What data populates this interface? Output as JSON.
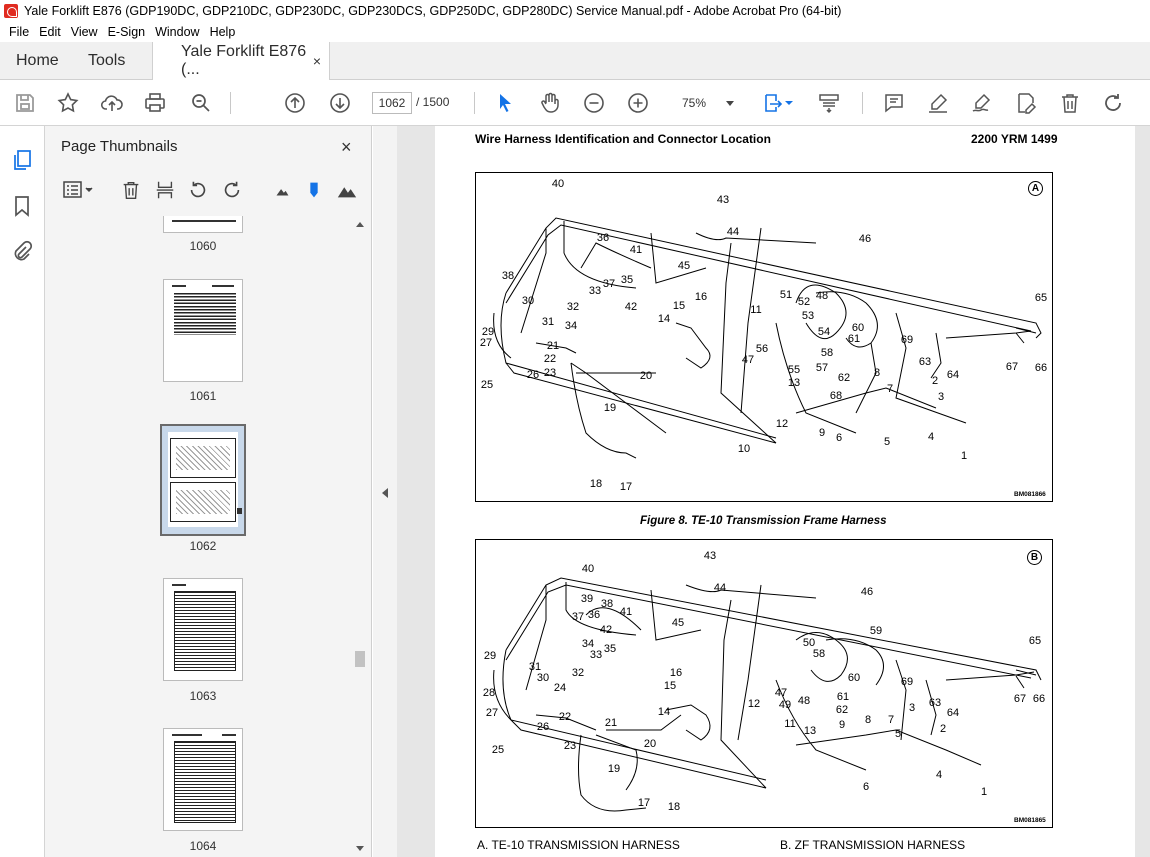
{
  "window": {
    "title": "Yale Forklift E876 (GDP190DC, GDP210DC, GDP230DC, GDP230DCS, GDP250DC, GDP280DC) Service Manual.pdf - Adobe Acrobat Pro (64-bit)"
  },
  "menu": [
    "File",
    "Edit",
    "View",
    "E-Sign",
    "Window",
    "Help"
  ],
  "tabs": {
    "home": "Home",
    "tools": "Tools",
    "doc": "Yale Forklift E876 (...",
    "close": "×"
  },
  "toolbar": {
    "page_current": "1062",
    "page_sep": "/ 1500",
    "zoom": "75%"
  },
  "thumbs": {
    "title": "Page Thumbnails",
    "close": "×",
    "pages": [
      {
        "label": "1060"
      },
      {
        "label": "1061"
      },
      {
        "label": "1062"
      },
      {
        "label": "1063"
      },
      {
        "label": "1064"
      }
    ],
    "selected": "1062"
  },
  "page": {
    "header_left": "Wire Harness Identification and Connector Location",
    "header_right": "2200 YRM 1499",
    "figA": {
      "badge": "A",
      "code": "BM081866",
      "labels": [
        "1",
        "2",
        "3",
        "4",
        "5",
        "6",
        "7",
        "8",
        "9",
        "10",
        "11",
        "12",
        "13",
        "14",
        "15",
        "16",
        "17",
        "18",
        "19",
        "20",
        "21",
        "22",
        "23",
        "25",
        "26",
        "27",
        "29",
        "30",
        "31",
        "32",
        "33",
        "34",
        "35",
        "36",
        "37",
        "38",
        "40",
        "41",
        "42",
        "43",
        "44",
        "45",
        "46",
        "47",
        "48",
        "51",
        "52",
        "53",
        "54",
        "55",
        "56",
        "57",
        "58",
        "60",
        "61",
        "62",
        "63",
        "64",
        "65",
        "66",
        "67",
        "68",
        "69"
      ]
    },
    "caption": "Figure 8.  TE-10 Transmission Frame Harness",
    "figB": {
      "badge": "B",
      "code": "BM081865",
      "labels": [
        "1",
        "2",
        "3",
        "4",
        "5",
        "6",
        "7",
        "8",
        "9",
        "11",
        "12",
        "13",
        "14",
        "15",
        "16",
        "17",
        "18",
        "19",
        "20",
        "21",
        "22",
        "23",
        "24",
        "25",
        "26",
        "27",
        "28",
        "29",
        "30",
        "31",
        "32",
        "33",
        "34",
        "35",
        "36",
        "37",
        "38",
        "39",
        "40",
        "41",
        "42",
        "43",
        "44",
        "45",
        "46",
        "47",
        "48",
        "49",
        "50",
        "58",
        "59",
        "60",
        "61",
        "62",
        "63",
        "64",
        "65",
        "66",
        "67",
        "69"
      ]
    },
    "legend": {
      "a": "A.   TE-10 TRANSMISSION HARNESS",
      "b": "B.   ZF TRANSMISSION HARNESS"
    }
  }
}
